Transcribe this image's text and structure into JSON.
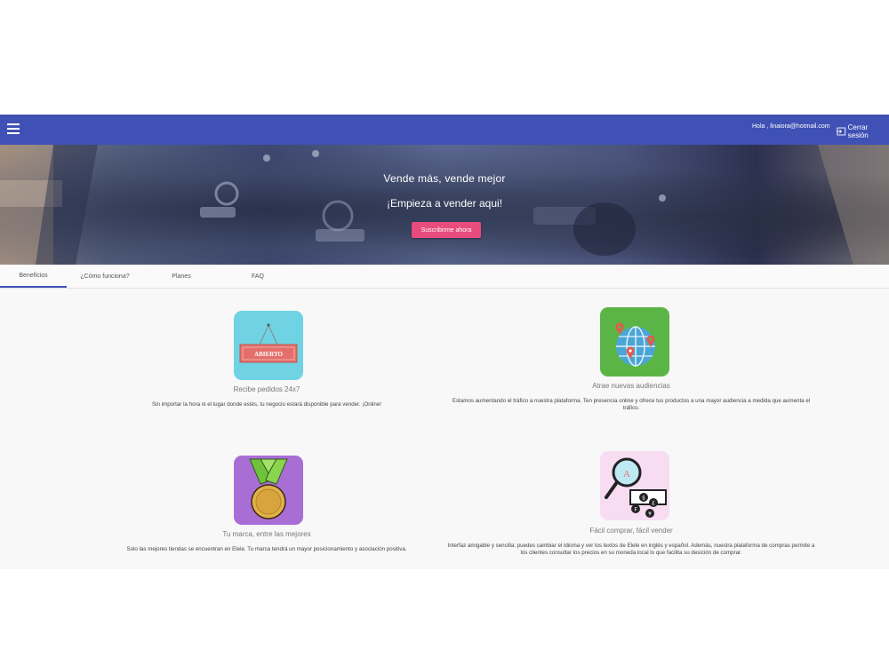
{
  "header": {
    "greeting": "Hola , linaiora@hotmail.com",
    "logout_label": "Cerrar sesión",
    "bar_color": "#3f51b5"
  },
  "hero": {
    "title": "Vende más, vende mejor",
    "subtitle": "¡Empieza a vender aqui!",
    "cta_label": "Suscribirme ahora"
  },
  "tabs": [
    {
      "label": "Beneficios",
      "active": true
    },
    {
      "label": "¿Cómo funciona?",
      "active": false
    },
    {
      "label": "Planes",
      "active": false
    },
    {
      "label": "FAQ",
      "active": false
    }
  ],
  "features": [
    {
      "icon": "open-sign-icon",
      "icon_label": "ABIERTO",
      "title": "Recibe pedidos 24x7",
      "description": "Sin importar la hora ni el lugar donde estés, tu negocio estará disponible para vender. ¡Online!"
    },
    {
      "icon": "globe-pins-icon",
      "title": "Atrae nuevas audiencias",
      "description": "Estamos aumentando el tráfico a nuestra plataforma. Ten presencia online y ofrece tus productos a una mayor audiencia a medida que aumenta el tráfico."
    },
    {
      "icon": "medal-icon",
      "title": "Tu marca, entre las mejores",
      "description": "Solo las mejores tiendas se encuentran en Elele. Tu marca tendrá un mayor posicionamiento y asociación positiva."
    },
    {
      "icon": "currency-magnifier-icon",
      "title": "Fácil comprar, fácil vender",
      "description": "Interfaz amigable y sencilla; puedes cambiar el idioma y ver los textos de Elele en inglés y español. Además, nuestra plataforma de compras permite a los clientes consultar los precios en su moneda local lo que facilita su desición de comprar."
    }
  ]
}
